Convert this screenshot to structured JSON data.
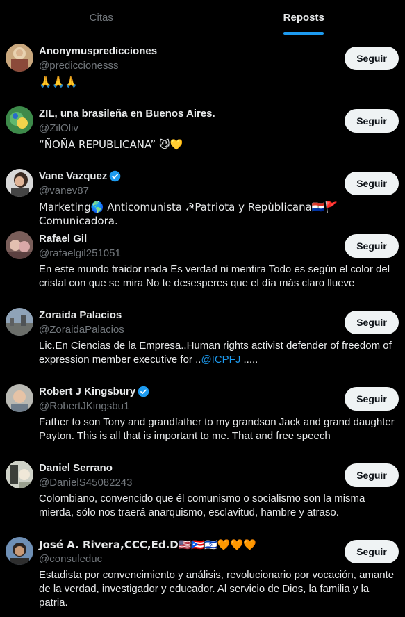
{
  "tabs": [
    {
      "label": "Citas",
      "active": false
    },
    {
      "label": "Reposts",
      "active": true
    }
  ],
  "follow_label": "Seguir",
  "accent_color": "#1d9bf0",
  "users": [
    {
      "name": "Anonymuspredicciones",
      "handle": "@prediccionesss",
      "verified": false,
      "bio": "🙏🙏🙏"
    },
    {
      "name": "ZIL, una brasileña en Buenos Aires.",
      "handle": "@ZilOliv_",
      "verified": false,
      "bio": "“ÑOÑA REPUBLICANA” 😼💛"
    },
    {
      "name": "Vane Vazquez",
      "handle": "@vanev87",
      "verified": true,
      "bio": "Marketing🌎 Anticomunista ☭Patriota y Repùblicana🇵🇾🚩 Comunicadora."
    },
    {
      "name": "Rafael Gil",
      "handle": "@rafaelgil251051",
      "verified": false,
      "bio": "En este mundo traidor nada Es verdad ni mentira Todo es según el color del cristal con que se mira No te desesperes que el día más claro llueve"
    },
    {
      "name": "Zoraida Palacios",
      "handle": "@ZoraidaPalacios",
      "verified": false,
      "bio": "Lic.En Ciencias de la Empresa..Human rights activist defender of freedom of expression member executive for ..",
      "bio_mention": "@ICPFJ",
      "bio_suffix": " ....."
    },
    {
      "name": "Robert J Kingsbury",
      "handle": "@RobertJKingsbu1",
      "verified": true,
      "bio": "Father to son Tony and grandfather to my grandson Jack and grand daughter Payton. This is all that is important to me. That and free speech"
    },
    {
      "name": "Daniel Serrano",
      "handle": "@DanielS45082243",
      "verified": false,
      "bio": "Colombiano, convencido que él comunismo o socialismo son la misma mierda, sólo nos traerá anarquismo, esclavitud, hambre y atraso."
    },
    {
      "name": "José A. Rivera,CCC,Ed.D🇺🇸🇵🇷🇮🇱🧡🧡🧡",
      "handle": "@consuleduc",
      "verified": false,
      "bio": "Estadista por convencimiento y análisis, revolucionario por vocación, amante de la verdad, investigador y educador. Al servicio de Dios, la familia y la patria."
    }
  ]
}
